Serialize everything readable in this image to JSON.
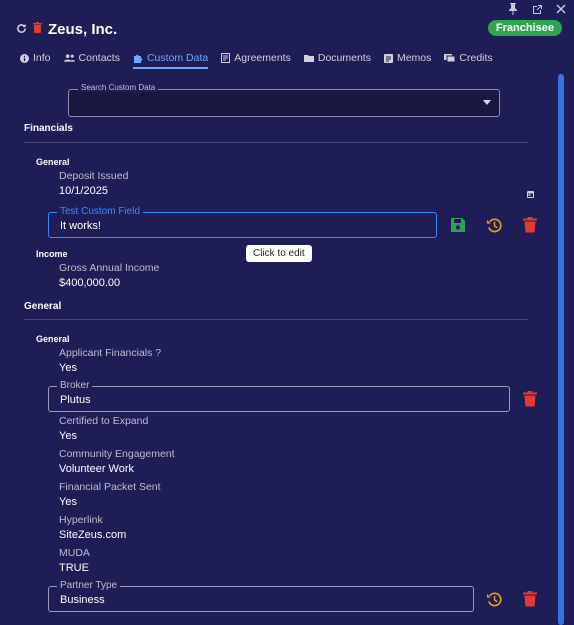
{
  "window": {
    "pin_icon": "pin-icon",
    "popout_icon": "popout-icon",
    "close_icon": "close-icon"
  },
  "header": {
    "title": "Zeus, Inc.",
    "badge": "Franchisee"
  },
  "tabs": [
    {
      "label": "Info",
      "icon": "info-icon"
    },
    {
      "label": "Contacts",
      "icon": "contacts-icon"
    },
    {
      "label": "Custom Data",
      "icon": "puzzle-icon",
      "active": true
    },
    {
      "label": "Agreements",
      "icon": "agreement-icon"
    },
    {
      "label": "Documents",
      "icon": "folder-icon"
    },
    {
      "label": "Memos",
      "icon": "memo-icon"
    },
    {
      "label": "Credits",
      "icon": "credits-icon"
    }
  ],
  "search": {
    "label": "Search Custom Data",
    "value": ""
  },
  "sections": {
    "financials": {
      "title": "Financials",
      "general": {
        "title": "General",
        "deposit_issued": {
          "label": "Deposit Issued",
          "value": "10/1/2025"
        },
        "test_custom_field": {
          "label": "Test Custom Field",
          "value": "It works!"
        }
      },
      "income": {
        "title": "Income",
        "gross_annual_income": {
          "label": "Gross Annual Income",
          "value": "$400,000.00"
        }
      }
    },
    "general": {
      "title": "General",
      "group": {
        "title": "General",
        "applicant_financials": {
          "label": "Applicant Financials ?",
          "value": "Yes"
        },
        "broker": {
          "label": "Broker",
          "value": "Plutus"
        },
        "certified_to_expand": {
          "label": "Certified to Expand",
          "value": "Yes"
        },
        "community_engagement": {
          "label": "Community Engagement",
          "value": "Volunteer Work"
        },
        "financial_packet_sent": {
          "label": "Financial Packet Sent",
          "value": "Yes"
        },
        "hyperlink": {
          "label": "Hyperlink",
          "value": "SiteZeus.com"
        },
        "muda": {
          "label": "MUDA",
          "value": "TRUE"
        },
        "partner_type": {
          "label": "Partner Type",
          "value": "Business"
        }
      }
    }
  },
  "tooltip": "Click to edit",
  "colors": {
    "background": "#1f1d55",
    "accent": "#3b8bff",
    "save": "#2ea44f",
    "history": "#e0a020",
    "delete": "#e53935"
  }
}
